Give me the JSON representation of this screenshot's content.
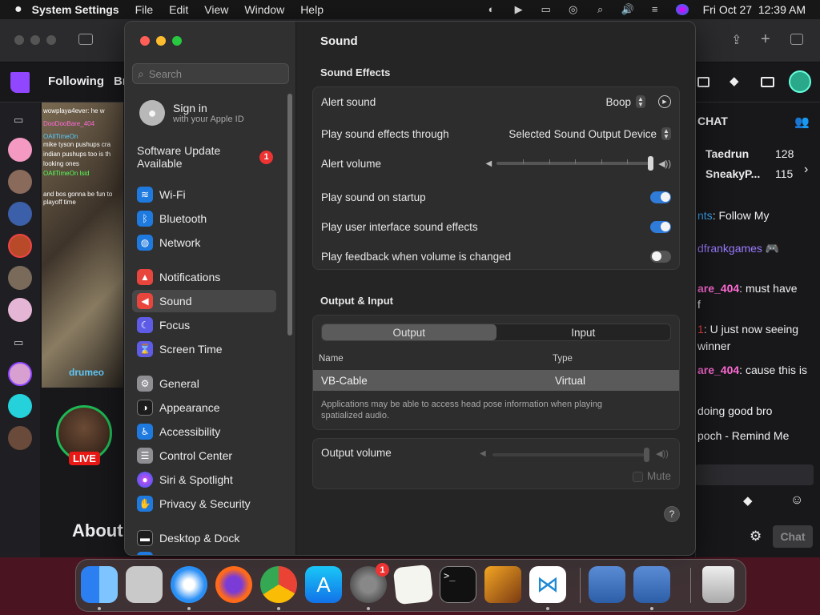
{
  "menubar": {
    "app": "System Settings",
    "items": [
      "File",
      "Edit",
      "View",
      "Window",
      "Help"
    ],
    "clock": "Fri Oct 27  12:39 AM"
  },
  "browser": {
    "following": "Following",
    "following_trunc": "Br",
    "chat_title": "CHAT",
    "about": "About",
    "live": "LIVE",
    "channel_brand": "drumeo",
    "chat_button": "Chat",
    "video_chat_lines": [
      "wowplaya4ever:  he w",
      "DooDooBare_404",
      "OAllTimeOn",
      "mike tyson pushups cra",
      "indian pushups too is th",
      "looking ones",
      "OAllTimeOn  lsid",
      "and bos gonna be fun to",
      "playoff time"
    ],
    "leaderboard": [
      {
        "name": "Taedrun",
        "score": "128"
      },
      {
        "name": "SneakyP...",
        "score": "115"
      }
    ],
    "chat_messages": [
      {
        "user": "nts",
        "text": ": Follow My"
      },
      {
        "user": "dfrankgames",
        "text": " 🎮"
      },
      {
        "user": "are_404",
        "text": ": must have"
      },
      {
        "user": "",
        "text": "f"
      },
      {
        "user": "1",
        "text": ": U just now seeing"
      },
      {
        "user": "",
        "text": "winner"
      },
      {
        "user": "are_404",
        "text": ": cause this is"
      },
      {
        "user": "",
        "text": "doing good bro"
      },
      {
        "user": "",
        "text": "poch - Remind Me"
      }
    ]
  },
  "settings": {
    "search_placeholder": "Search",
    "account": {
      "title": "Sign in",
      "subtitle": "with your Apple ID"
    },
    "update": {
      "label": "Software Update Available",
      "count": "1"
    },
    "sidebar": [
      {
        "label": "Wi-Fi",
        "icon": "wifi-icon",
        "color": "#1f7ae0"
      },
      {
        "label": "Bluetooth",
        "icon": "bluetooth-icon",
        "color": "#1f7ae0"
      },
      {
        "label": "Network",
        "icon": "globe-icon",
        "color": "#1f7ae0"
      },
      {
        "label": "Notifications",
        "icon": "bell-icon",
        "color": "#e8453c"
      },
      {
        "label": "Sound",
        "icon": "speaker-icon",
        "color": "#e8453c"
      },
      {
        "label": "Focus",
        "icon": "moon-icon",
        "color": "#5e5ce6"
      },
      {
        "label": "Screen Time",
        "icon": "hourglass-icon",
        "color": "#5e5ce6"
      },
      {
        "label": "General",
        "icon": "gear-icon",
        "color": "#8e8e93"
      },
      {
        "label": "Appearance",
        "icon": "appearance-icon",
        "color": "#1c1c1c"
      },
      {
        "label": "Accessibility",
        "icon": "accessibility-icon",
        "color": "#1f7ae0"
      },
      {
        "label": "Control Center",
        "icon": "control-center-icon",
        "color": "#8e8e93"
      },
      {
        "label": "Siri & Spotlight",
        "icon": "siri-icon",
        "color": "#a43bd1"
      },
      {
        "label": "Privacy & Security",
        "icon": "hand-icon",
        "color": "#1f7ae0"
      },
      {
        "label": "Desktop & Dock",
        "icon": "dock-icon",
        "color": "#1c1c1c"
      }
    ],
    "title": "Sound",
    "sound_effects": {
      "heading": "Sound Effects",
      "alert_sound_label": "Alert sound",
      "alert_sound_value": "Boop",
      "play_through_label": "Play sound effects through",
      "play_through_value": "Selected Sound Output Device",
      "alert_volume_label": "Alert volume",
      "alert_volume_level": 1.0,
      "startup_label": "Play sound on startup",
      "startup_on": true,
      "ui_sounds_label": "Play user interface sound effects",
      "ui_sounds_on": true,
      "feedback_label": "Play feedback when volume is changed",
      "feedback_on": false
    },
    "output_input": {
      "heading": "Output & Input",
      "tabs": [
        "Output",
        "Input"
      ],
      "selected_tab": "Output",
      "col_name": "Name",
      "col_type": "Type",
      "device_name": "VB-Cable",
      "device_type": "Virtual",
      "note": "Applications may be able to access head pose information when playing spatialized audio.",
      "output_volume_label": "Output volume",
      "output_volume_level": 1.0,
      "mute_label": "Mute"
    },
    "help": "?"
  },
  "dock": {
    "apps": [
      "Finder",
      "Launchpad",
      "Safari",
      "Firefox",
      "Chrome",
      "App Store",
      "System Settings",
      "TextEdit",
      "Terminal",
      "GarageBand",
      "Visual Studio Code",
      "VirtualBox",
      "VirtualBox VM",
      "Trash"
    ],
    "settings_badge": "1",
    "terminal_prompt": ">_"
  }
}
